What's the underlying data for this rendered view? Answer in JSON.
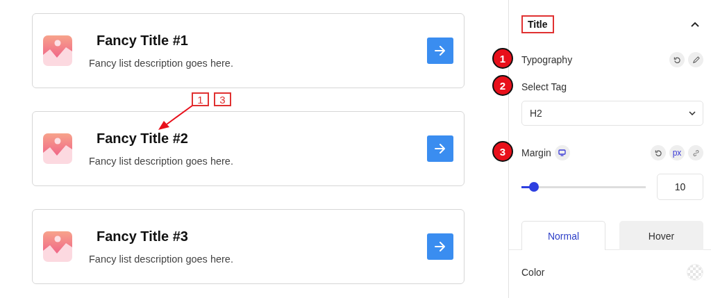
{
  "cards": [
    {
      "title": "Fancy Title #1",
      "description": "Fancy list description goes here."
    },
    {
      "title": "Fancy Title #2",
      "description": "Fancy list description goes here."
    },
    {
      "title": "Fancy Title #3",
      "description": "Fancy list description goes here."
    }
  ],
  "callout": {
    "labels": [
      "1",
      "3"
    ]
  },
  "panel": {
    "section_title": "Title",
    "expanded": true,
    "typography": {
      "marker": "1",
      "label": "Typography"
    },
    "select_tag": {
      "marker": "2",
      "label": "Select Tag",
      "value": "H2"
    },
    "margin": {
      "marker": "3",
      "label": "Margin",
      "unit": "px",
      "level": 0.1,
      "value": "10"
    },
    "tabs": [
      {
        "label": "Normal",
        "selected": true
      },
      {
        "label": "Hover",
        "selected": false
      }
    ],
    "color": {
      "label": "Color"
    }
  }
}
